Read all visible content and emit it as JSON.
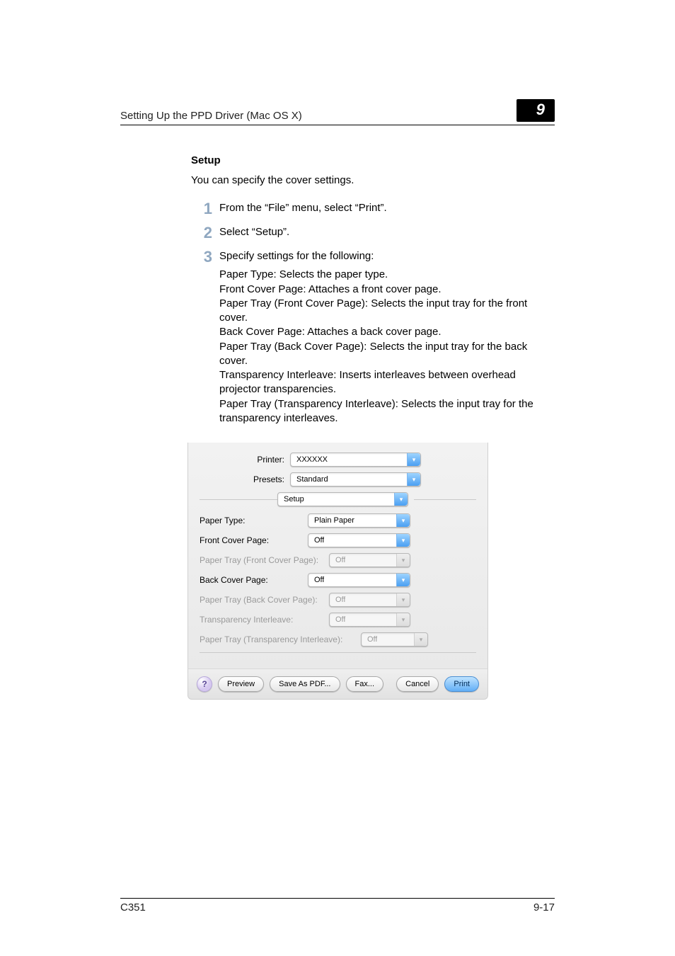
{
  "header": {
    "running": "Setting Up the PPD Driver (Mac OS X)",
    "chapter": "9"
  },
  "section": {
    "title": "Setup",
    "intro": "You can specify the cover settings."
  },
  "steps": [
    {
      "n": "1",
      "text": "From the “File” menu, select “Print”."
    },
    {
      "n": "2",
      "text": "Select “Setup”."
    },
    {
      "n": "3",
      "text": "Specify settings for the following:"
    }
  ],
  "details": [
    "Paper Type: Selects the paper type.",
    "Front Cover Page: Attaches a front cover page.",
    "Paper Tray (Front Cover Page): Selects the input tray for the front cover.",
    "Back Cover Page: Attaches a back cover page.",
    "Paper Tray (Back Cover Page): Selects the input tray for the back cover.",
    "Transparency Interleave: Inserts interleaves between overhead projector transparencies.",
    "Paper Tray (Transparency Interleave): Selects the input tray for the transparency interleaves."
  ],
  "dialog": {
    "printer_label": "Printer:",
    "printer_value": "XXXXXX",
    "presets_label": "Presets:",
    "presets_value": "Standard",
    "panel_value": "Setup",
    "rows": {
      "paper_type": {
        "label": "Paper Type:",
        "value": "Plain Paper",
        "disabled": false
      },
      "front_cover": {
        "label": "Front Cover Page:",
        "value": "Off",
        "disabled": false
      },
      "front_tray": {
        "label": "Paper Tray (Front Cover Page):",
        "value": "Off",
        "disabled": true
      },
      "back_cover": {
        "label": "Back Cover Page:",
        "value": "Off",
        "disabled": false
      },
      "back_tray": {
        "label": "Paper Tray (Back Cover Page):",
        "value": "Off",
        "disabled": true
      },
      "trans": {
        "label": "Transparency Interleave:",
        "value": "Off",
        "disabled": true
      },
      "trans_tray": {
        "label": "Paper Tray (Transparency Interleave):",
        "value": "Off",
        "disabled": true
      }
    },
    "buttons": {
      "help": "?",
      "preview": "Preview",
      "save_pdf": "Save As PDF...",
      "fax": "Fax...",
      "cancel": "Cancel",
      "print": "Print"
    }
  },
  "footer": {
    "model": "C351",
    "page": "9-17"
  }
}
